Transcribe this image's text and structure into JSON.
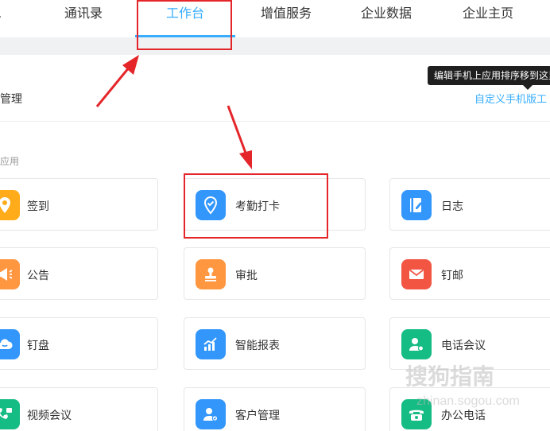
{
  "nav": {
    "items": [
      {
        "label": "通讯录"
      },
      {
        "label": "工作台"
      },
      {
        "label": "增值服务"
      },
      {
        "label": "企业数据"
      },
      {
        "label": "企业主页"
      }
    ],
    "active_index": 1
  },
  "manage": {
    "title": "管理",
    "custom_link": "自定义手机版工",
    "tooltip": "编辑手机上应用排序移到这里"
  },
  "section": {
    "label": "应用"
  },
  "apps": [
    {
      "label": "签到",
      "icon": "location-pin-icon",
      "color": "#ffab1a"
    },
    {
      "label": "考勤打卡",
      "icon": "check-location-icon",
      "color": "#3296fa"
    },
    {
      "label": "日志",
      "icon": "notebook-pen-icon",
      "color": "#3296fa"
    },
    {
      "label": "公告",
      "icon": "megaphone-icon",
      "color": "#ff9640"
    },
    {
      "label": "审批",
      "icon": "stamp-icon",
      "color": "#ff9640"
    },
    {
      "label": "钉邮",
      "icon": "envelope-icon",
      "color": "#f25643"
    },
    {
      "label": "钉盘",
      "icon": "cloud-drive-icon",
      "color": "#3296fa"
    },
    {
      "label": "智能报表",
      "icon": "bar-chart-icon",
      "color": "#3296fa"
    },
    {
      "label": "电话会议",
      "icon": "conference-call-icon",
      "color": "#15bc83"
    },
    {
      "label": "视频会议",
      "icon": "video-call-icon",
      "color": "#15bc83"
    },
    {
      "label": "客户管理",
      "icon": "customer-icon",
      "color": "#3296fa"
    },
    {
      "label": "办公电话",
      "icon": "desk-phone-icon",
      "color": "#15bc83"
    }
  ],
  "colors": {
    "accent": "#38adff",
    "highlight_box": "#e4262b"
  },
  "watermark": {
    "text": "搜狗指南",
    "sub": "zhinan.sogou.com"
  }
}
